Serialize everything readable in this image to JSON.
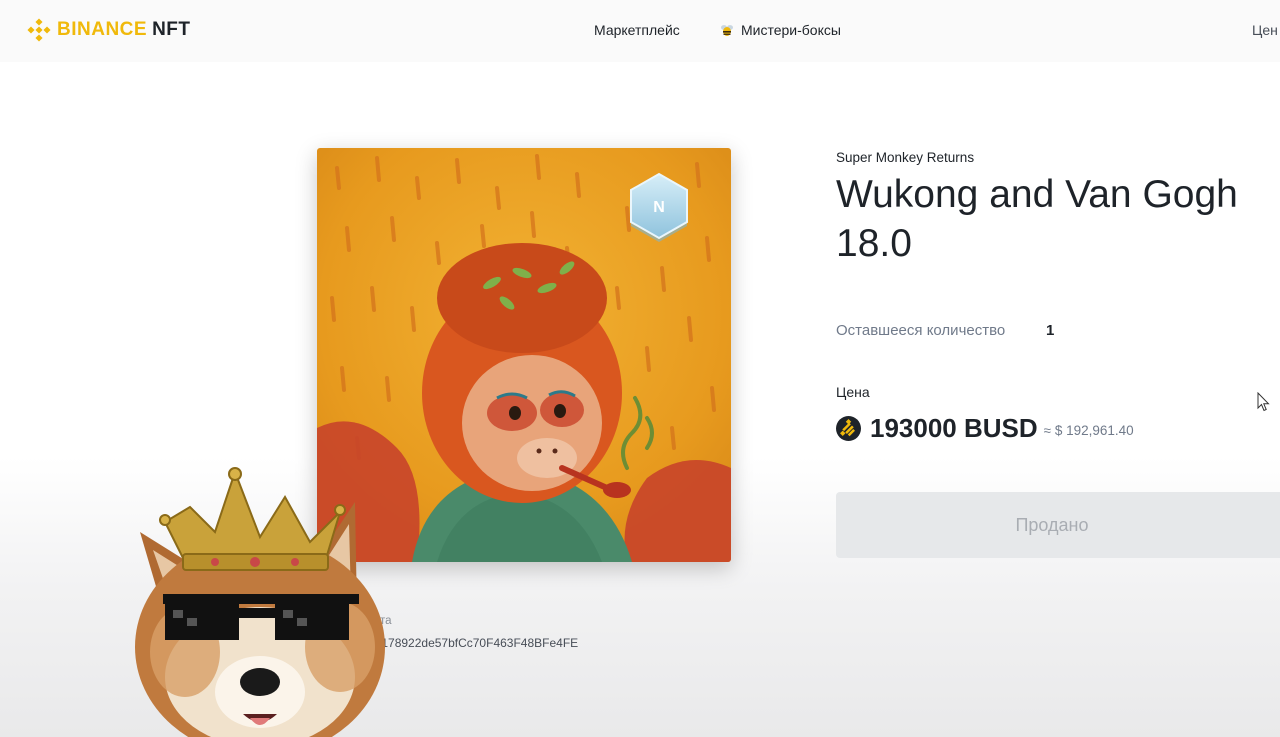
{
  "header": {
    "logo_brand": "BINANCE",
    "logo_product": "NFT",
    "nav": {
      "marketplace": "Маркетплейс",
      "mystery_boxes": "Мистери-боксы",
      "cut_item": "Цен"
    }
  },
  "item": {
    "collection": "Super Monkey Returns",
    "title": "Wukong and Van Gogh 18.0",
    "quantity_label": "Оставшееся количество",
    "quantity_value": "1",
    "price_label": "Цена",
    "price_amount": "193000 BUSD",
    "price_usd": "≈ $ 192,961.40",
    "sold_label": "Продано",
    "contract_label": "ракта",
    "contract_address": "3e178922de57bfCc70F463F48BFe4FE",
    "rarity_badge_letter": "N"
  },
  "icons": {
    "logo": "binance-logo-icon",
    "mystery": "bee-icon",
    "currency": "busd-icon",
    "badge": "rarity-badge-icon"
  },
  "colors": {
    "brand_yellow": "#F0B90B",
    "text_primary": "#1E2329",
    "text_secondary": "#707A8A",
    "button_disabled_bg": "#E6E8EA",
    "button_disabled_text": "#A9ADB3",
    "badge_blue": "#A9D6EC"
  }
}
